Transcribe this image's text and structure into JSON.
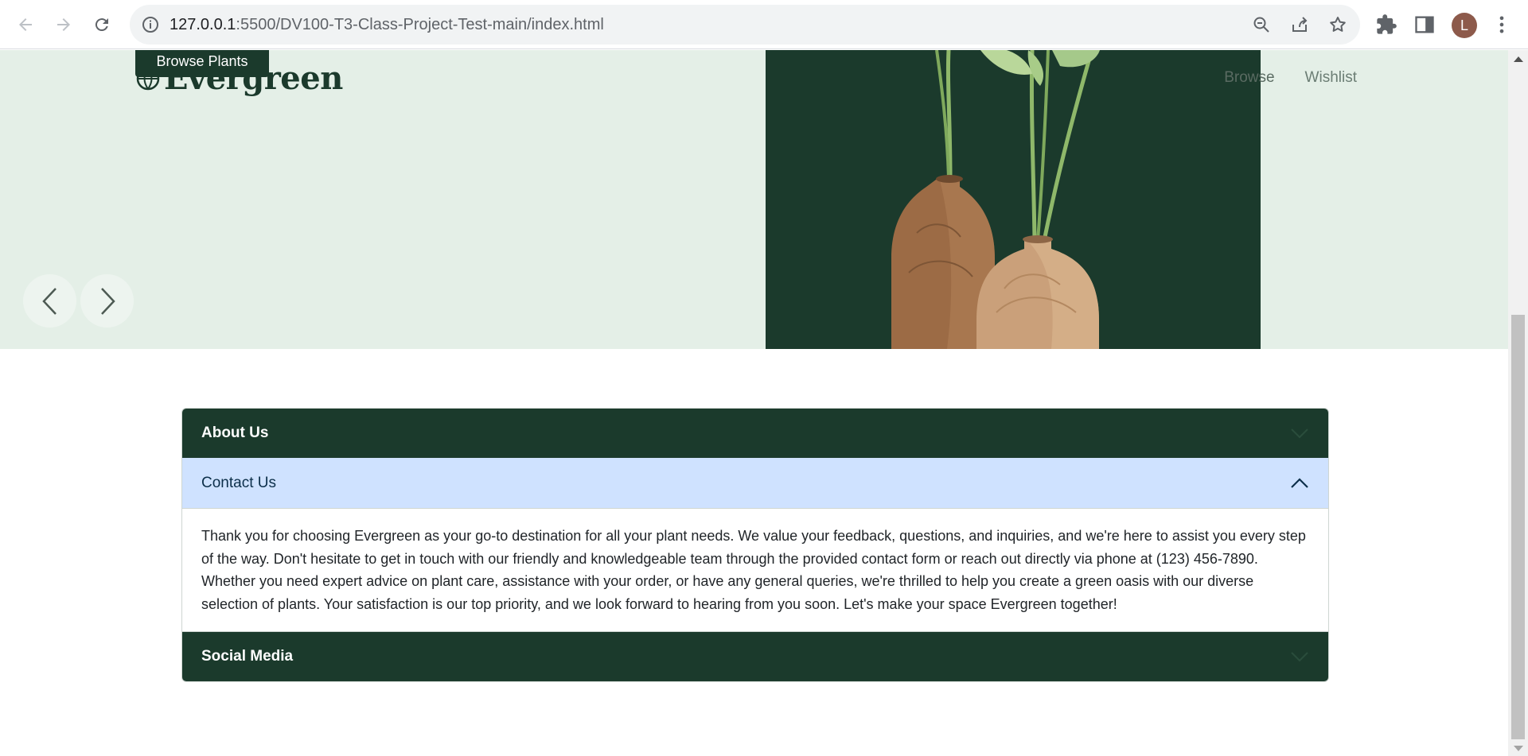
{
  "browser": {
    "url_host": "127.0.0.1",
    "url_rest": ":5500/DV100-T3-Class-Project-Test-main/index.html",
    "avatar_letter": "L"
  },
  "hero": {
    "browse_button": "Browse Plants",
    "logo_text": "Evergreen",
    "nav": [
      "Browse",
      "Wishlist"
    ]
  },
  "accordion": {
    "items": [
      {
        "title": "About Us",
        "expanded": false
      },
      {
        "title": "Contact Us",
        "expanded": true,
        "body": "Thank you for choosing Evergreen as your go-to destination for all your plant needs. We value your feedback, questions, and inquiries, and we're here to assist you every step of the way. Don't hesitate to get in touch with our friendly and knowledgeable team through the provided contact form or reach out directly via phone at (123) 456-7890. Whether you need expert advice on plant care, assistance with your order, or have any general queries, we're thrilled to help you create a green oasis with our diverse selection of plants. Your satisfaction is our top priority, and we look forward to hearing from you soon. Let's make your space Evergreen together!"
      },
      {
        "title": "Social Media",
        "expanded": false
      }
    ]
  },
  "colors": {
    "brand_dark_green": "#1b3a2c",
    "hero_background": "#e4efe7",
    "active_header": "#cfe2ff"
  }
}
